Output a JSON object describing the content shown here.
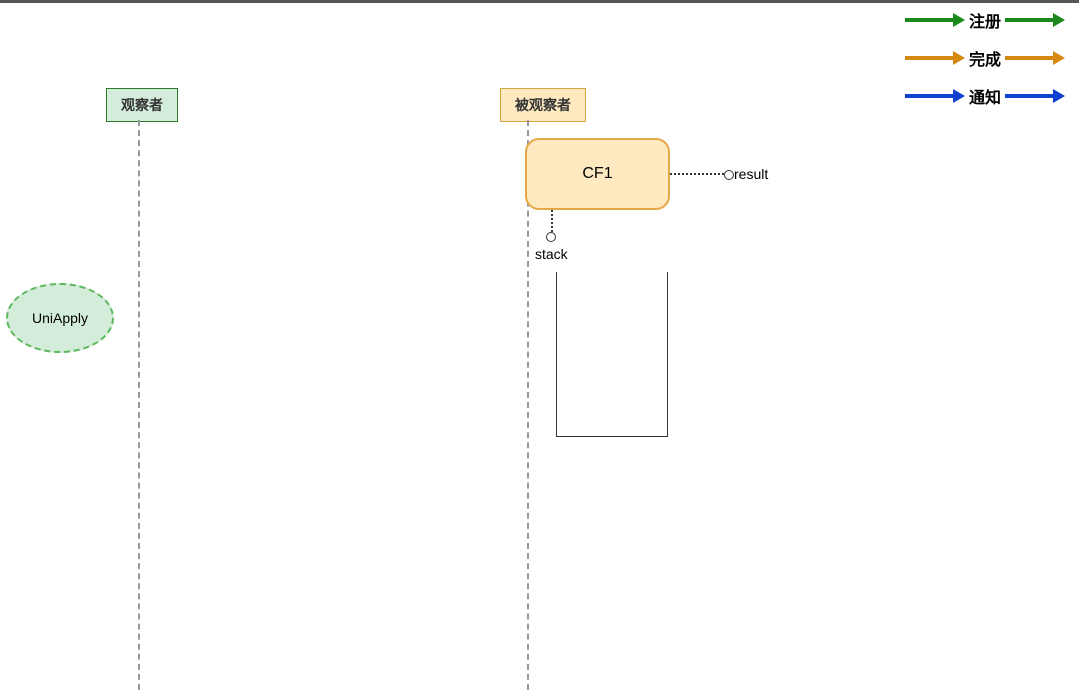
{
  "labels": {
    "observer": "观察者",
    "observed": "被观察者"
  },
  "nodes": {
    "cf1": "CF1",
    "uniapply": "UniApply"
  },
  "annotations": {
    "result": "result",
    "stack": "stack"
  },
  "legend": {
    "register": "注册",
    "complete": "完成",
    "notify": "通知",
    "colors": {
      "register": "#1a8a1a",
      "complete": "#d68910",
      "notify": "#1040d0"
    }
  }
}
